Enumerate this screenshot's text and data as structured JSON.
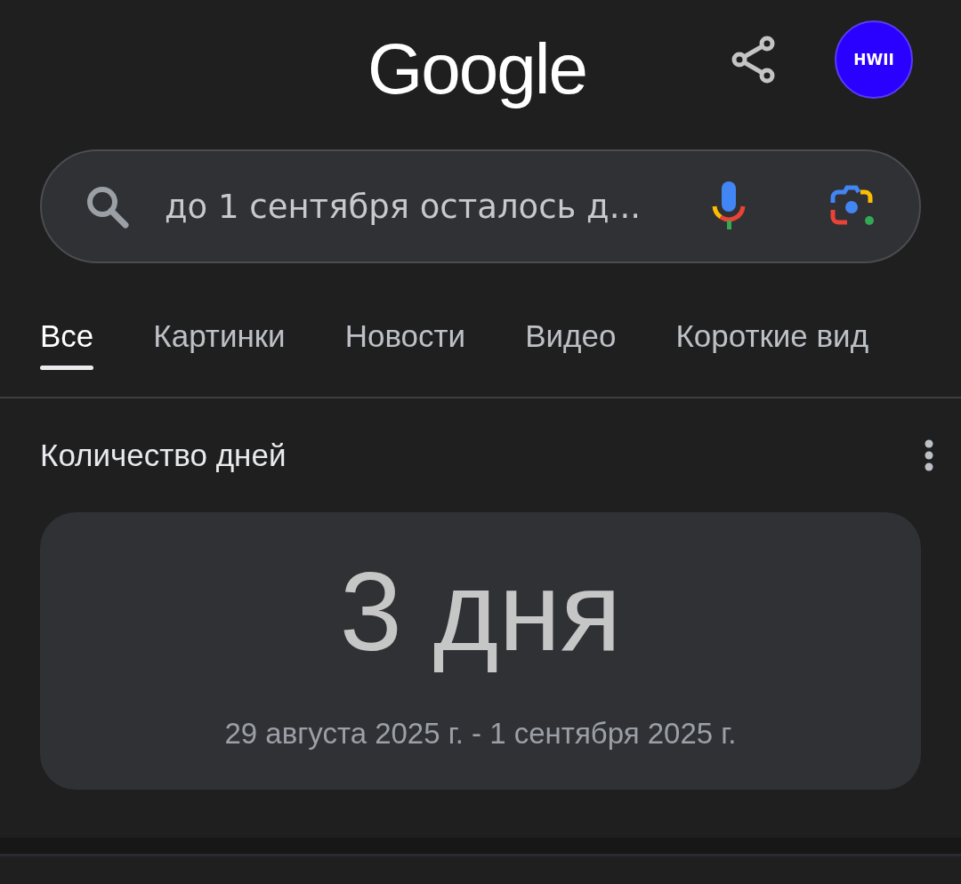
{
  "header": {
    "logo": "Google",
    "avatar": "HWII"
  },
  "search": {
    "value": "до 1 сентября осталось д..."
  },
  "tabs": [
    {
      "label": "Все",
      "selected": true
    },
    {
      "label": "Картинки",
      "selected": false
    },
    {
      "label": "Новости",
      "selected": false
    },
    {
      "label": "Видео",
      "selected": false
    },
    {
      "label": "Короткие вид",
      "selected": false
    }
  ],
  "result": {
    "title": "Количество дней",
    "value": "3 дня",
    "range": "29 августа 2025 г. - 1 сентября 2025 г."
  }
}
